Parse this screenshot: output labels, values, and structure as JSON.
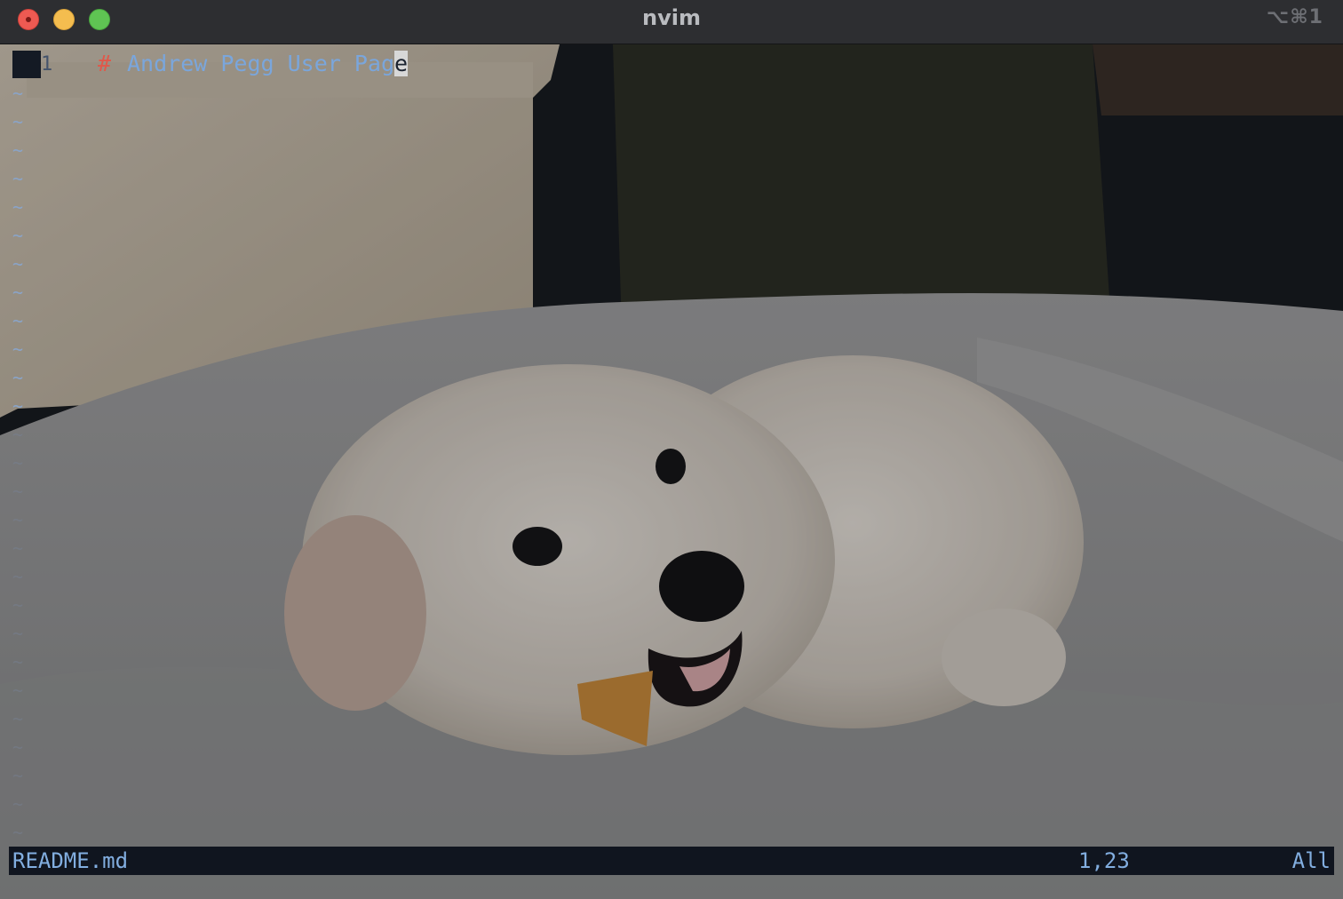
{
  "window": {
    "title": "nvim",
    "shortcut": "⌥⌘1"
  },
  "editor": {
    "line_number": "1",
    "heading_marker": "#",
    "heading_text": "Andrew Pegg User Pag",
    "cursor_char": "e",
    "empty_line_marker": "~"
  },
  "statusline": {
    "filename": "README.md",
    "position": "1,23",
    "scroll": "All"
  },
  "colors": {
    "accent": "#7aa6dc",
    "heading_marker": "#e0584a",
    "statusline_bg": "#10151f"
  },
  "background": {
    "subject": "white puppy chewing on a grey blanket"
  }
}
